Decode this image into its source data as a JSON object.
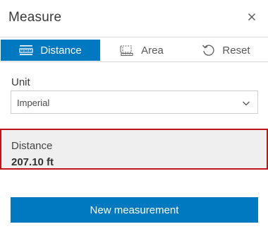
{
  "panel": {
    "title": "Measure",
    "close_icon": "close-icon"
  },
  "tabs": [
    {
      "label": "Distance",
      "icon": "ruler-distance-icon",
      "active": true
    },
    {
      "label": "Area",
      "icon": "area-measure-icon",
      "active": false
    },
    {
      "label": "Reset",
      "icon": "reset-icon",
      "active": false
    }
  ],
  "unit": {
    "label": "Unit",
    "selected": "Imperial"
  },
  "result": {
    "label": "Distance",
    "value": "207.10 ft"
  },
  "actions": {
    "new_measurement": "New measurement"
  },
  "colors": {
    "accent": "#0079c1",
    "highlight_border": "#c0141b",
    "result_background": "#efefef"
  }
}
